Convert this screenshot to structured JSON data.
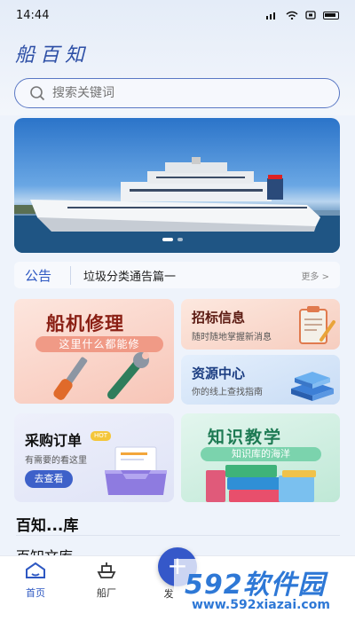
{
  "status_bar": {
    "time": "14:44"
  },
  "app": {
    "title": "船百知"
  },
  "search": {
    "placeholder": "搜索关键词"
  },
  "notice": {
    "tag": "公告",
    "text": "垃圾分类通告篇一",
    "more": "更多 >"
  },
  "cards": {
    "repair": {
      "title": "船机修理",
      "subtitle": "这里什么都能修"
    },
    "bidding": {
      "title": "招标信息",
      "subtitle": "随时随地掌握新消息"
    },
    "resources": {
      "title": "资源中心",
      "subtitle": "你的线上查找指南"
    },
    "orders": {
      "title": "采购订单",
      "badge": "HOT",
      "subtitle": "有需要的看这里",
      "button": "去查看"
    },
    "knowledge": {
      "title": "知识教学",
      "subtitle": "知识库的海洋"
    }
  },
  "section": {
    "title": "百知...库",
    "peek": "百知文库"
  },
  "tabbar": {
    "items": [
      {
        "label": "首页"
      },
      {
        "label": "船厂"
      },
      {
        "label": "发"
      }
    ]
  },
  "fab": {
    "label": "+"
  },
  "watermark": {
    "logo": "592软件园",
    "url": "www.592xiazai.com"
  },
  "colors": {
    "accent": "#2e58c2",
    "fab": "#3558c9"
  }
}
